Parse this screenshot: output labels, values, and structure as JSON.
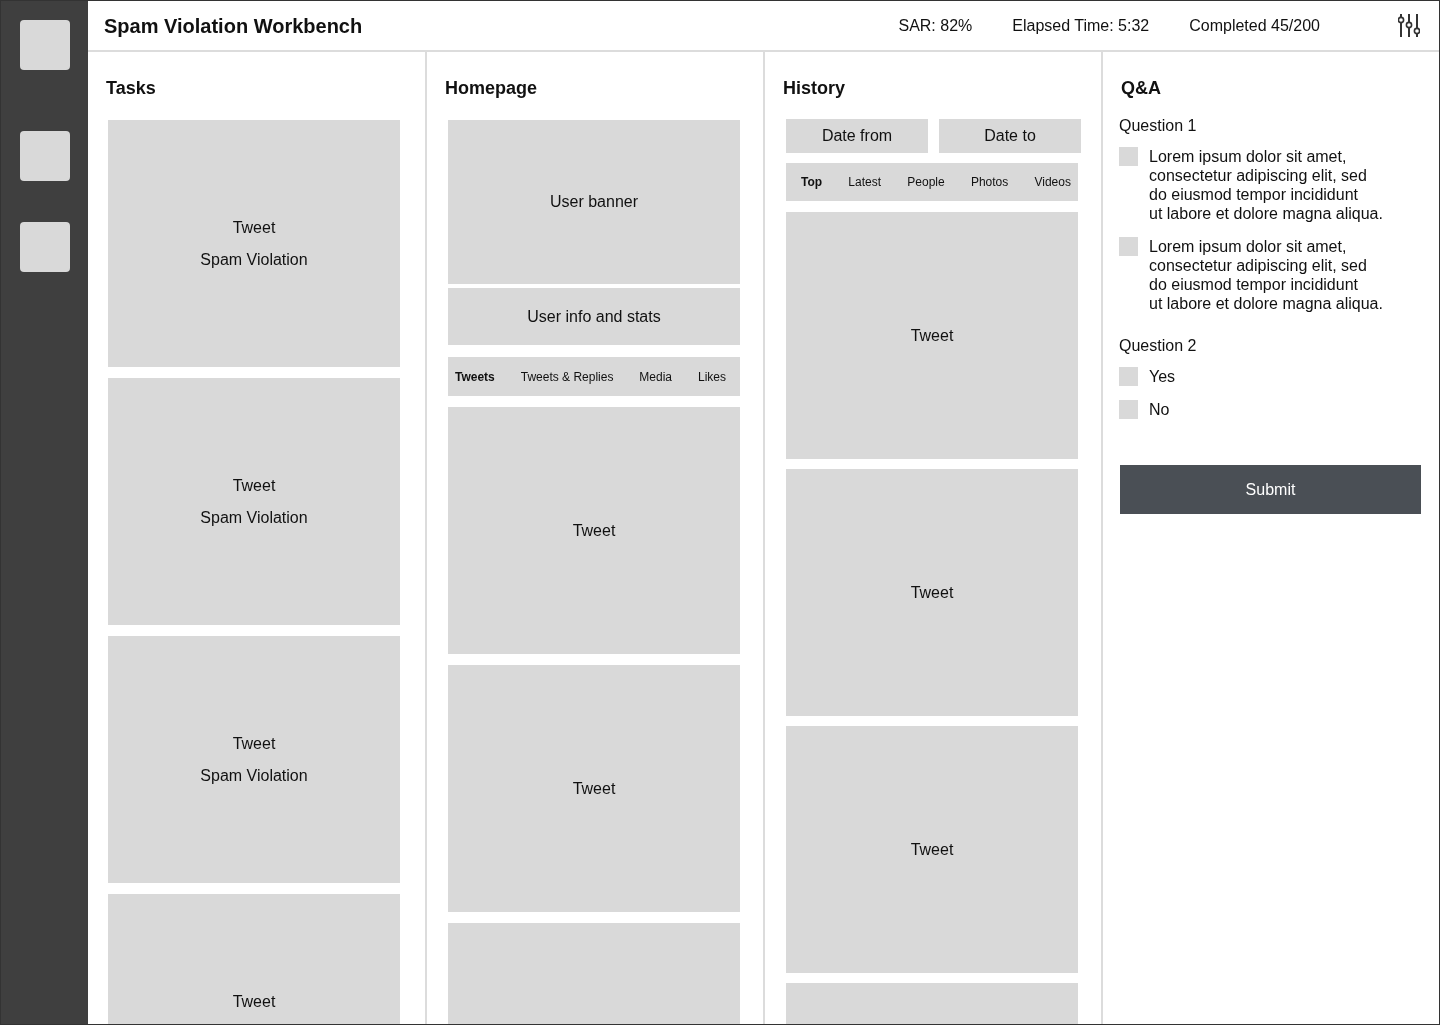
{
  "header": {
    "title": "Spam Violation Workbench",
    "stats": [
      "SAR: 82%",
      "Elapsed Time: 5:32",
      "Completed 45/200"
    ]
  },
  "tasks": {
    "title": "Tasks",
    "cards": [
      {
        "label": "Tweet",
        "violation": "Spam Violation"
      },
      {
        "label": "Tweet",
        "violation": "Spam Violation"
      },
      {
        "label": "Tweet",
        "violation": "Spam Violation"
      },
      {
        "label": "Tweet"
      }
    ]
  },
  "homepage": {
    "title": "Homepage",
    "banner": "User banner",
    "user_info": "User info and stats",
    "tabs": [
      {
        "label": "Tweets",
        "selected": true
      },
      {
        "label": "Tweets & Replies",
        "selected": false
      },
      {
        "label": "Media",
        "selected": false
      },
      {
        "label": "Likes",
        "selected": false
      }
    ],
    "tweets": [
      "Tweet",
      "Tweet"
    ],
    "more_below": true
  },
  "history": {
    "title": "History",
    "date_from": "Date from",
    "date_to": "Date to",
    "tabs": [
      {
        "label": "Top",
        "selected": true
      },
      {
        "label": "Latest",
        "selected": false
      },
      {
        "label": "People",
        "selected": false
      },
      {
        "label": "Photos",
        "selected": false
      },
      {
        "label": "Videos",
        "selected": false
      }
    ],
    "tweets": [
      "Tweet",
      "Tweet",
      "Tweet"
    ],
    "more_below": true
  },
  "qa": {
    "title": "Q&A",
    "questions": [
      {
        "label": "Question 1",
        "options": [
          {
            "text": "Lorem ipsum dolor sit amet,\nconsectetur adipiscing elit, sed\ndo eiusmod tempor incididunt\nut labore et dolore magna aliqua.",
            "checked": false
          },
          {
            "text": "Lorem ipsum dolor sit amet,\nconsectetur adipiscing elit, sed\ndo eiusmod tempor incididunt\nut labore et dolore magna aliqua.",
            "checked": false
          }
        ]
      },
      {
        "label": "Question 2",
        "options": [
          {
            "text": "Yes",
            "checked": false
          },
          {
            "text": "No",
            "checked": false
          }
        ]
      }
    ],
    "submit": "Submit"
  }
}
